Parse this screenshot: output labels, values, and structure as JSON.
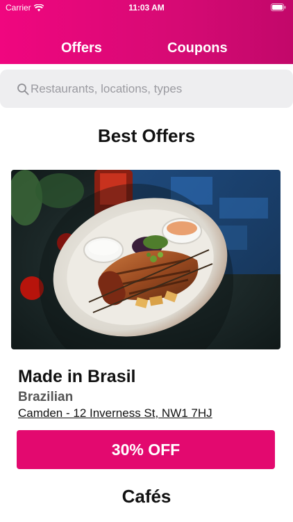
{
  "status_bar": {
    "carrier": "Carrier",
    "time": "11:03 AM"
  },
  "tabs": [
    {
      "label": "Offers"
    },
    {
      "label": "Coupons"
    }
  ],
  "search": {
    "placeholder": "Restaurants, locations, types"
  },
  "sections": {
    "best_offers": "Best Offers",
    "cafes": "Cafés"
  },
  "offer": {
    "name": "Made in Brasil",
    "cuisine": "Brazilian",
    "address": "Camden - 12 Inverness St, NW1 7HJ",
    "button_label": "30% OFF"
  },
  "icons": {
    "wifi": "wifi-icon",
    "battery": "battery-icon",
    "search": "search-icon"
  },
  "colors": {
    "brand": "#e3096f",
    "header_start": "#f0067f",
    "header_end": "#c2086a"
  }
}
